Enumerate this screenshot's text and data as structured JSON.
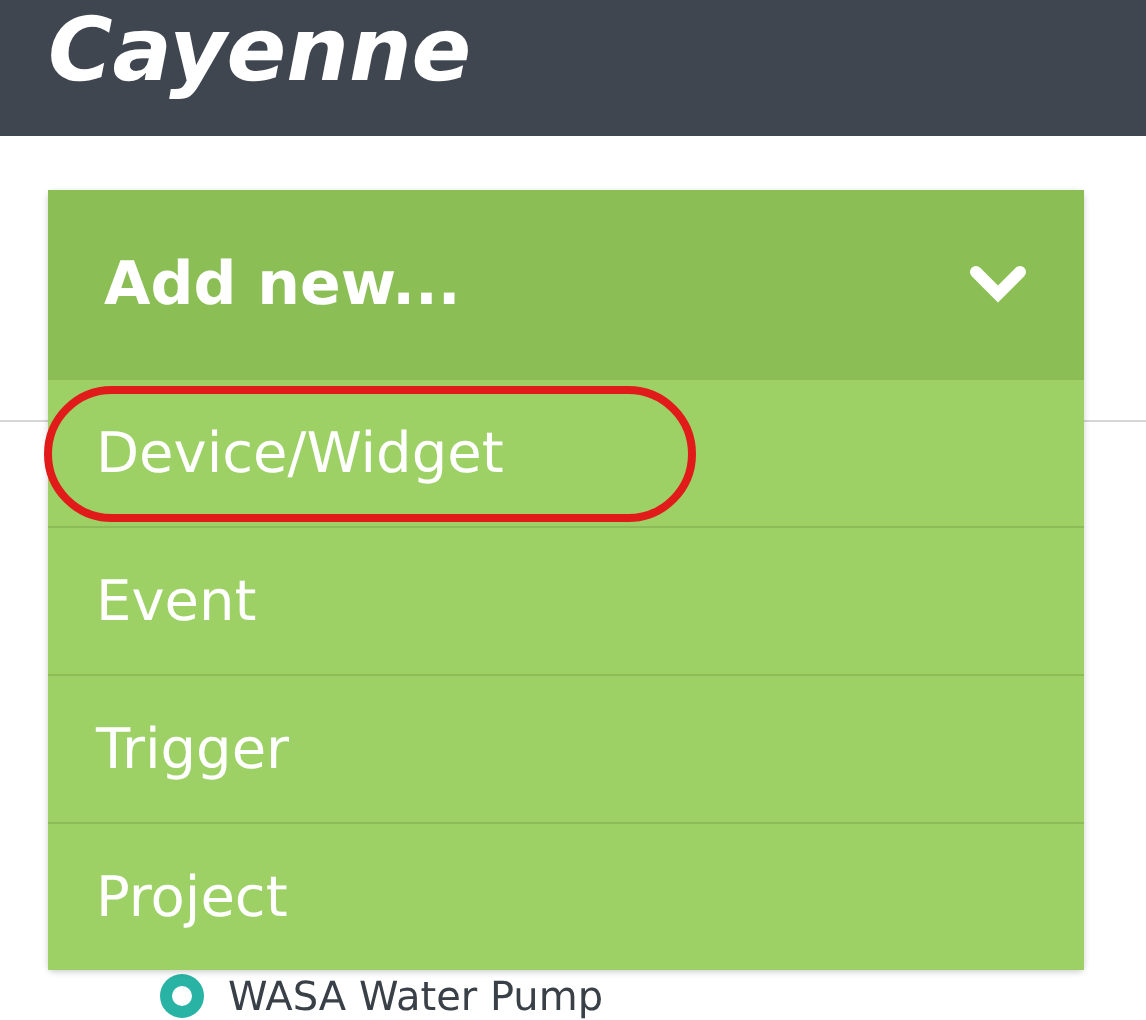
{
  "header": {
    "title": "Cayenne"
  },
  "dropdown": {
    "label": "Add new...",
    "expanded": true,
    "items": [
      {
        "label": "Device/Widget",
        "highlighted": true
      },
      {
        "label": "Event",
        "highlighted": false
      },
      {
        "label": "Trigger",
        "highlighted": false
      },
      {
        "label": "Project",
        "highlighted": false
      }
    ]
  },
  "devices": [
    {
      "name": "WASA Water Pump"
    }
  ]
}
